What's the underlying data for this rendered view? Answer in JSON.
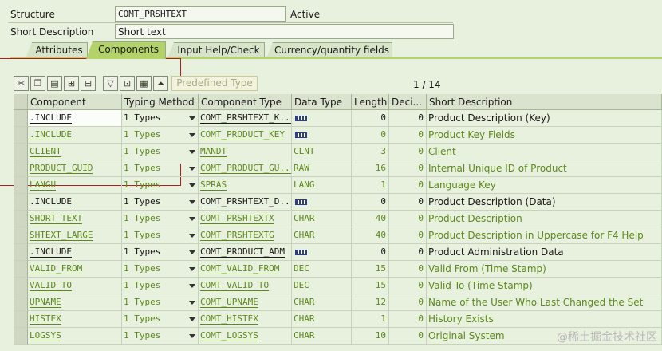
{
  "header": {
    "structure_label": "Structure",
    "structure_value": "COMT_PRSHTEXT",
    "status": "Active",
    "short_desc_label": "Short Description",
    "short_desc_value": "Short text"
  },
  "tabs": [
    {
      "label": "Attributes",
      "active": false
    },
    {
      "label": "Components",
      "active": true
    },
    {
      "label": "Input Help/Check",
      "active": false
    },
    {
      "label": "Currency/quantity fields",
      "active": false
    }
  ],
  "toolbar": {
    "icons": [
      "cut-icon",
      "copy-icon",
      "paste-icon",
      "insert-row-icon",
      "delete-row-icon",
      "filter-icon",
      "select-all-icon",
      "deselect-icon",
      "sort-icon"
    ],
    "predefined_type_label": "Predefined Type",
    "pager": "1 / 14"
  },
  "table": {
    "columns": [
      "Component",
      "Typing Method",
      "Component Type",
      "Data Type",
      "Length",
      "Deci...",
      "Short Description"
    ],
    "rows": [
      {
        "component": ".INCLUDE",
        "typing": "1 Types",
        "ctype": "COMT_PRSHTEXT_K...",
        "dtype": "",
        "dtype_icon": true,
        "length": "0",
        "dec": "0",
        "desc": "Product Description (Key)",
        "style": "input"
      },
      {
        "component": ".INCLUDE",
        "typing": "1 Types",
        "ctype": "COMT_PRODUCT_KEY",
        "dtype": "",
        "dtype_icon": true,
        "length": "0",
        "dec": "0",
        "desc": "Product Key Fields",
        "style": "inh"
      },
      {
        "component": "CLIENT",
        "typing": "1 Types",
        "ctype": "MANDT",
        "dtype": "CLNT",
        "dtype_icon": false,
        "length": "3",
        "dec": "0",
        "desc": "Client",
        "style": "inh"
      },
      {
        "component": "PRODUCT_GUID",
        "typing": "1 Types",
        "ctype": "COMT_PRODUCT_GU...",
        "dtype": "RAW",
        "dtype_icon": false,
        "length": "16",
        "dec": "0",
        "desc": "Internal Unique ID of Product",
        "style": "inh"
      },
      {
        "component": "LANGU",
        "typing": "1 Types",
        "ctype": "SPRAS",
        "dtype": "LANG",
        "dtype_icon": false,
        "length": "1",
        "dec": "0",
        "desc": "Language Key",
        "style": "inh"
      },
      {
        "component": ".INCLUDE",
        "typing": "1 Types",
        "ctype": "COMT_PRSHTEXT_D...",
        "dtype": "",
        "dtype_icon": true,
        "length": "0",
        "dec": "0",
        "desc": "Product Description (Data)",
        "style": "blk"
      },
      {
        "component": "SHORT_TEXT",
        "typing": "1 Types",
        "ctype": "COMT_PRSHTEXTX",
        "dtype": "CHAR",
        "dtype_icon": false,
        "length": "40",
        "dec": "0",
        "desc": "Product Description",
        "style": "inh"
      },
      {
        "component": "SHTEXT_LARGE",
        "typing": "1 Types",
        "ctype": "COMT_PRSHTEXTG",
        "dtype": "CHAR",
        "dtype_icon": false,
        "length": "40",
        "dec": "0",
        "desc": "Product Description in Uppercase for F4 Help",
        "style": "inh"
      },
      {
        "component": ".INCLUDE",
        "typing": "1 Types",
        "ctype": "COMT_PRODUCT_ADM",
        "dtype": "",
        "dtype_icon": true,
        "length": "0",
        "dec": "0",
        "desc": "Product Administration Data",
        "style": "blk"
      },
      {
        "component": "VALID_FROM",
        "typing": "1 Types",
        "ctype": "COMT_VALID_FROM",
        "dtype": "DEC",
        "dtype_icon": false,
        "length": "15",
        "dec": "0",
        "desc": "Valid From (Time Stamp)",
        "style": "inh"
      },
      {
        "component": "VALID_TO",
        "typing": "1 Types",
        "ctype": "COMT_VALID_TO",
        "dtype": "DEC",
        "dtype_icon": false,
        "length": "15",
        "dec": "0",
        "desc": "Valid To (Time Stamp)",
        "style": "inh"
      },
      {
        "component": "UPNAME",
        "typing": "1 Types",
        "ctype": "COMT_UPNAME",
        "dtype": "CHAR",
        "dtype_icon": false,
        "length": "12",
        "dec": "0",
        "desc": "Name of the User Who Last Changed the Set",
        "style": "inh"
      },
      {
        "component": "HISTEX",
        "typing": "1 Types",
        "ctype": "COMT_HISTEX",
        "dtype": "CHAR",
        "dtype_icon": false,
        "length": "1",
        "dec": "0",
        "desc": "History Exists",
        "style": "inh"
      },
      {
        "component": "LOGSYS",
        "typing": "1 Types",
        "ctype": "COMT_LOGSYS",
        "dtype": "CHAR",
        "dtype_icon": false,
        "length": "10",
        "dec": "0",
        "desc": "Original System",
        "style": "inh"
      }
    ]
  },
  "watermark": "@稀土掘金技术社区"
}
